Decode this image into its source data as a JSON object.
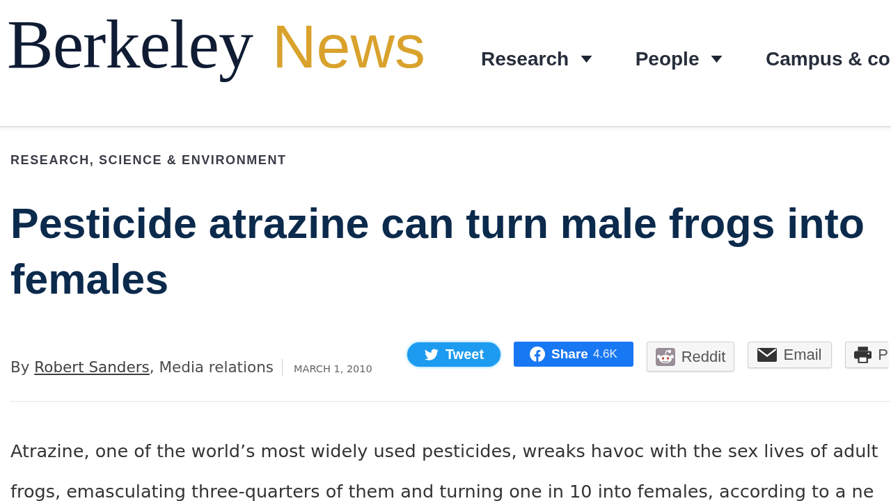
{
  "header": {
    "logo": {
      "wordmark": "Berkeley",
      "section": "News"
    },
    "nav": [
      {
        "label": "Research",
        "dropdown": true
      },
      {
        "label": "People",
        "dropdown": true
      },
      {
        "label": "Campus & co",
        "dropdown": false
      }
    ]
  },
  "article": {
    "category": "RESEARCH, SCIENCE & ENVIRONMENT",
    "title": "Pesticide atrazine can turn male frogs into females",
    "byline": {
      "prefix": "By",
      "author": "Robert Sanders",
      "affiliation": ", Media relations",
      "date": "MARCH 1, 2010"
    },
    "share_buttons": [
      {
        "kind": "twitter",
        "label": "Tweet"
      },
      {
        "kind": "facebook",
        "label": "Share",
        "count": "4.6K"
      },
      {
        "kind": "reddit",
        "label": "Reddit"
      },
      {
        "kind": "email",
        "label": "Email"
      },
      {
        "kind": "print",
        "label": "P"
      }
    ],
    "body_lines": [
      "Atrazine, one of the world’s most widely used pesticides, wreaks havoc with the sex lives of adult",
      "frogs, emasculating three-quarters of them and turning one in 10 into females, according to a ne"
    ]
  }
}
